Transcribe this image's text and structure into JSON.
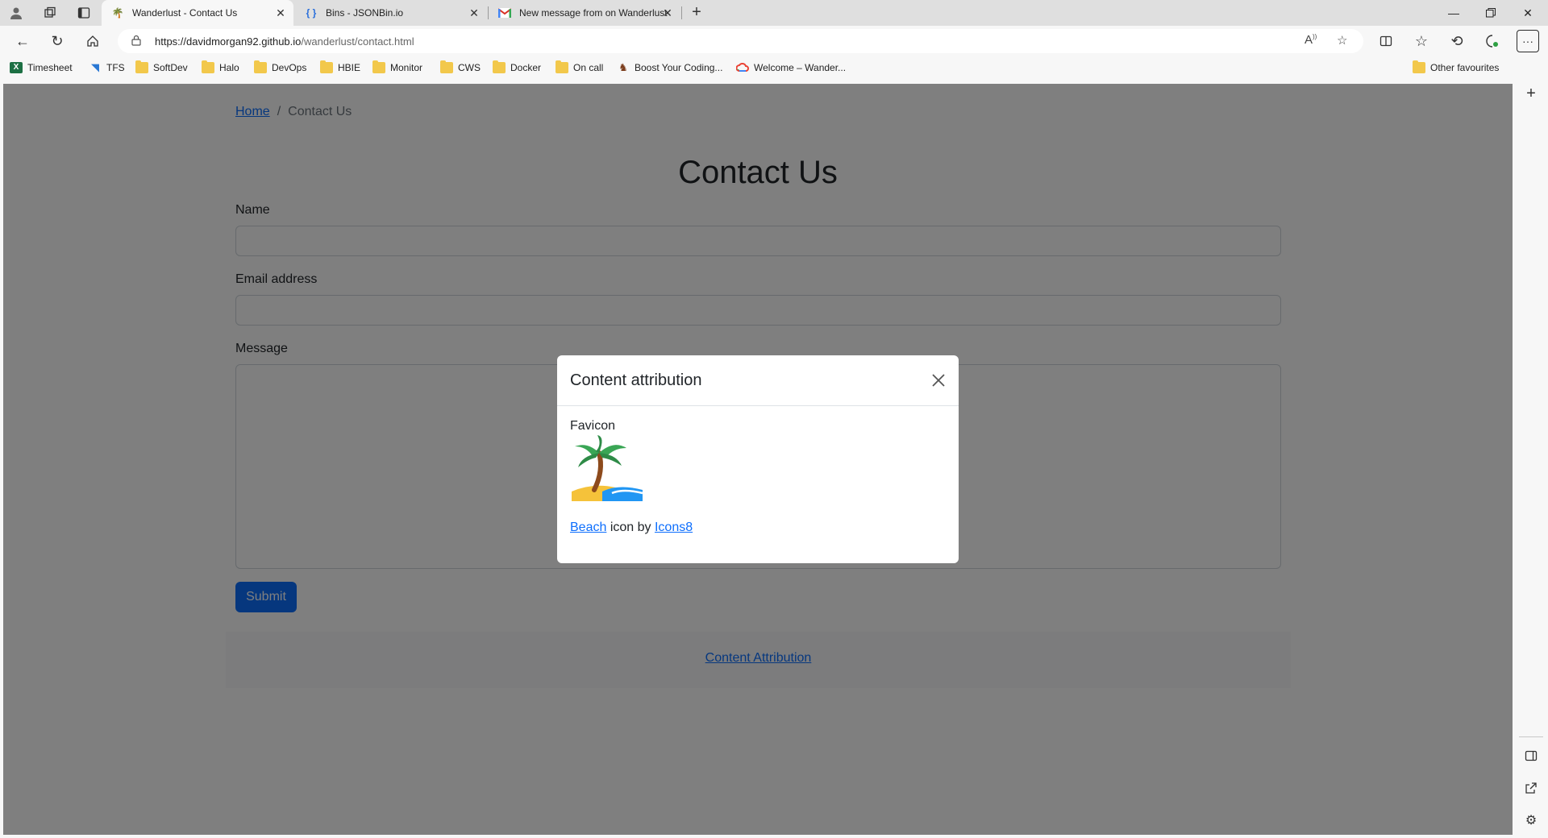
{
  "browser": {
    "tabs": [
      {
        "title": "Wanderlust - Contact Us",
        "active": true,
        "favicon": "palm-icon"
      },
      {
        "title": "Bins - JSONBin.io",
        "active": false,
        "favicon": "braces-icon"
      },
      {
        "title": "New message from on Wanderlust",
        "active": false,
        "favicon": "gmail-icon"
      }
    ],
    "url_host": "https://davidmorgan92.github.io",
    "url_path": "/wanderlust/contact.html",
    "bookmarks": [
      {
        "label": "Timesheet",
        "icon": "excel-icon"
      },
      {
        "label": "TFS",
        "icon": "visual-studio-icon"
      },
      {
        "label": "SoftDev",
        "icon": "folder-icon"
      },
      {
        "label": "Halo",
        "icon": "folder-icon"
      },
      {
        "label": "DevOps",
        "icon": "folder-icon"
      },
      {
        "label": "HBIE",
        "icon": "folder-icon"
      },
      {
        "label": "Monitor",
        "icon": "folder-icon"
      },
      {
        "label": "CWS",
        "icon": "folder-icon"
      },
      {
        "label": "Docker",
        "icon": "folder-icon"
      },
      {
        "label": "On call",
        "icon": "folder-icon"
      },
      {
        "label": "Boost Your Coding...",
        "icon": "boost-icon"
      },
      {
        "label": "Welcome – Wander...",
        "icon": "google-cloud-icon"
      }
    ],
    "other_favourites": "Other favourites"
  },
  "page": {
    "breadcrumb_home": "Home",
    "breadcrumb_separator": "/",
    "breadcrumb_current": "Contact Us",
    "heading": "Contact Us",
    "name_label": "Name",
    "email_label": "Email address",
    "message_label": "Message",
    "submit_label": "Submit",
    "footer_link": "Content Attribution"
  },
  "modal": {
    "title": "Content attribution",
    "subtitle": "Favicon",
    "credit_link1": "Beach",
    "credit_middle": " icon by ",
    "credit_link2": "Icons8"
  },
  "colors": {
    "primary": "#0d6efd",
    "backdrop": "rgba(0,0,0,0.5)"
  }
}
